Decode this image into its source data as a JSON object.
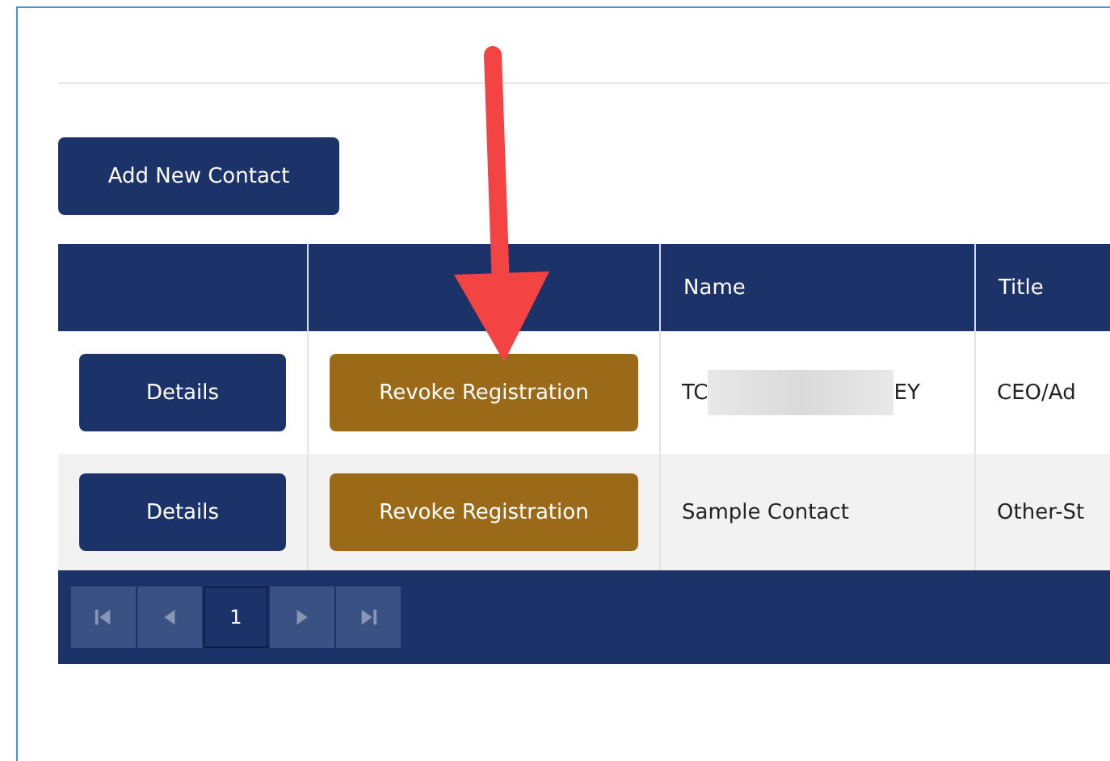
{
  "add_button": "Add New Contact",
  "table": {
    "columns": [
      "",
      "",
      "Name",
      "Title"
    ],
    "rows": [
      {
        "details": "Details",
        "revoke": "Revoke Registration",
        "name": {
          "redacted": true,
          "start": "TC",
          "end": "EY"
        },
        "title": "CEO/Ad"
      },
      {
        "details": "Details",
        "revoke": "Revoke Registration",
        "name": {
          "redacted": false,
          "start": "Sample Contact"
        },
        "title": "Other-St"
      }
    ]
  },
  "pager": {
    "nav": [
      {
        "kind": "first",
        "disabled": true
      },
      {
        "kind": "prev",
        "disabled": true
      }
    ],
    "pages": [
      {
        "label": "1",
        "selected": true
      }
    ],
    "nav_after": [
      {
        "kind": "next",
        "disabled": true
      },
      {
        "kind": "last",
        "disabled": true
      }
    ]
  },
  "annotation": {
    "kind": "arrow"
  }
}
